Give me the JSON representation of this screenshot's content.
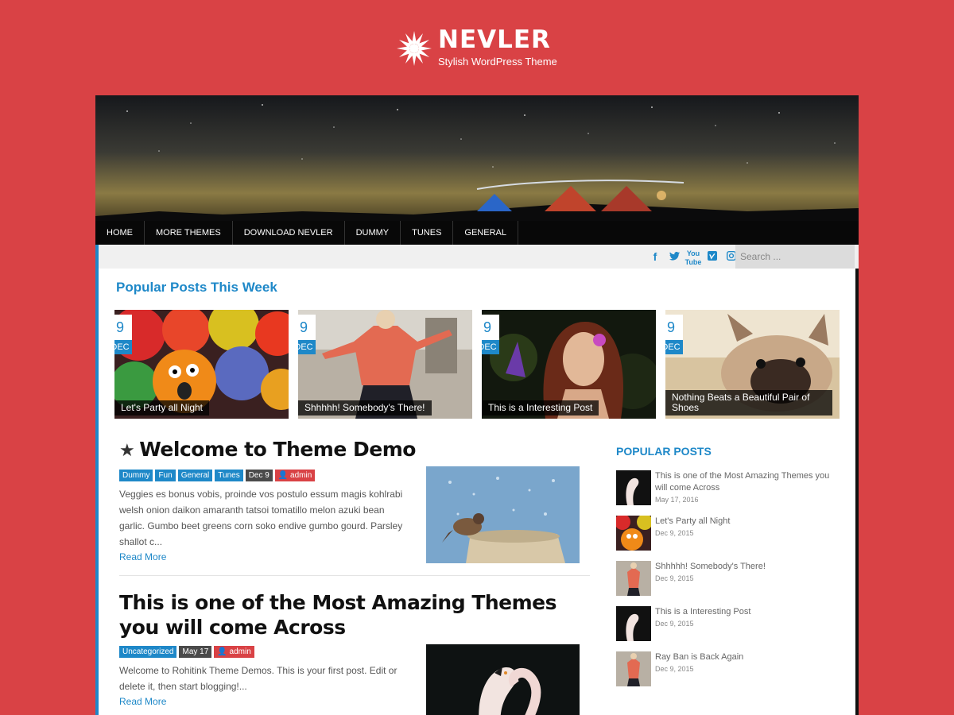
{
  "site": {
    "name": "NEVLER",
    "tagline": "Stylish WordPress Theme"
  },
  "nav": [
    "HOME",
    "MORE THEMES",
    "DOWNLOAD NEVLER",
    "DUMMY",
    "TUNES",
    "GENERAL"
  ],
  "social_icons": [
    "facebook-icon",
    "twitter-icon",
    "youtube-icon",
    "vimeo-icon",
    "instagram-icon"
  ],
  "search": {
    "placeholder": "Search ..."
  },
  "popular_week": {
    "title": "Popular Posts This Week",
    "cards": [
      {
        "day": "9",
        "month": "DEC",
        "title": "Let's Party all Night"
      },
      {
        "day": "9",
        "month": "DEC",
        "title": "Shhhhh! Somebody's There!"
      },
      {
        "day": "9",
        "month": "DEC",
        "title": "This is a Interesting Post"
      },
      {
        "day": "9",
        "month": "DEC",
        "title": "Nothing Beats a Beautiful Pair of Shoes"
      }
    ]
  },
  "posts": [
    {
      "title": "Welcome to Theme Demo",
      "sticky": true,
      "tags": [
        "Dummy",
        "Fun",
        "General",
        "Tunes"
      ],
      "date": "Dec 9",
      "author": "admin",
      "excerpt": "Veggies es bonus vobis, proinde vos postulo essum magis kohlrabi welsh onion daikon amaranth tatsoi tomatillo melon azuki bean garlic. Gumbo beet greens corn soko endive gumbo gourd. Parsley shallot c...",
      "read_more": "Read More"
    },
    {
      "title": "This is one of the Most Amazing Themes you will come Across",
      "sticky": false,
      "tags": [
        "Uncategorized"
      ],
      "date": "May 17",
      "author": "admin",
      "excerpt": "Welcome to Rohitink Theme Demos. This is your first post. Edit or delete it, then start blogging!...",
      "read_more": "Read More"
    }
  ],
  "sidebar": {
    "title": "POPULAR POSTS",
    "items": [
      {
        "title": "This is one of the Most Amazing Themes you will come Across",
        "date": "May 17, 2016"
      },
      {
        "title": "Let's Party all Night",
        "date": "Dec 9, 2015"
      },
      {
        "title": "Shhhhh! Somebody's There!",
        "date": "Dec 9, 2015"
      },
      {
        "title": "This is a Interesting Post",
        "date": "Dec 9, 2015"
      },
      {
        "title": "Ray Ban is Back Again",
        "date": "Dec 9, 2015"
      }
    ]
  },
  "colors": {
    "brand": "#d94245",
    "accent": "#1e88c8",
    "nav_bg": "#080808"
  }
}
